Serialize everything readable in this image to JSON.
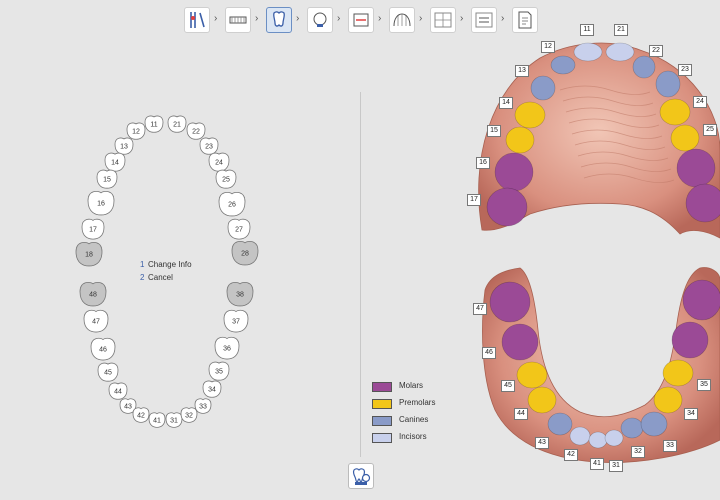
{
  "toolbar": {
    "steps": [
      {
        "name": "step-prepare-icon",
        "active": false
      },
      {
        "name": "step-scan-icon",
        "active": false
      },
      {
        "name": "step-tooth-segmentation-icon",
        "active": true
      },
      {
        "name": "step-face-icon",
        "active": false
      },
      {
        "name": "step-align-icon",
        "active": false
      },
      {
        "name": "step-arch-icon",
        "active": false
      },
      {
        "name": "step-measure-icon",
        "active": false
      },
      {
        "name": "step-setup-icon",
        "active": false
      },
      {
        "name": "step-report-icon",
        "active": false
      }
    ]
  },
  "tooth_chart": {
    "teeth": [
      {
        "num": "11",
        "state": "present"
      },
      {
        "num": "12",
        "state": "present"
      },
      {
        "num": "13",
        "state": "present"
      },
      {
        "num": "14",
        "state": "present"
      },
      {
        "num": "15",
        "state": "present"
      },
      {
        "num": "16",
        "state": "present"
      },
      {
        "num": "17",
        "state": "present"
      },
      {
        "num": "18",
        "state": "missing"
      },
      {
        "num": "21",
        "state": "present"
      },
      {
        "num": "22",
        "state": "present"
      },
      {
        "num": "23",
        "state": "present"
      },
      {
        "num": "24",
        "state": "present"
      },
      {
        "num": "25",
        "state": "present"
      },
      {
        "num": "26",
        "state": "present"
      },
      {
        "num": "27",
        "state": "present"
      },
      {
        "num": "28",
        "state": "missing"
      },
      {
        "num": "48",
        "state": "missing"
      },
      {
        "num": "47",
        "state": "present"
      },
      {
        "num": "46",
        "state": "present"
      },
      {
        "num": "45",
        "state": "present"
      },
      {
        "num": "44",
        "state": "present"
      },
      {
        "num": "43",
        "state": "present"
      },
      {
        "num": "42",
        "state": "present"
      },
      {
        "num": "41",
        "state": "present"
      },
      {
        "num": "31",
        "state": "present"
      },
      {
        "num": "32",
        "state": "present"
      },
      {
        "num": "33",
        "state": "present"
      },
      {
        "num": "34",
        "state": "present"
      },
      {
        "num": "35",
        "state": "present"
      },
      {
        "num": "36",
        "state": "present"
      },
      {
        "num": "37",
        "state": "present"
      },
      {
        "num": "38",
        "state": "missing"
      }
    ],
    "present_fill": "#ffffff",
    "missing_fill": "#c4c4c4"
  },
  "context_menu": {
    "change_info_key": "1",
    "change_info": "Change Info",
    "cancel_key": "2",
    "cancel": "Cancel"
  },
  "legend": [
    {
      "label": "Molars",
      "color": "#9b4a96"
    },
    {
      "label": "Premolars",
      "color": "#f2c619"
    },
    {
      "label": "Canines",
      "color": "#8a9bc8"
    },
    {
      "label": "Incisors",
      "color": "#c8d0ec"
    }
  ],
  "model_view": {
    "gum_color": "#d9907f",
    "upper_labels": [
      "11",
      "12",
      "13",
      "14",
      "15",
      "16",
      "17",
      "21",
      "22",
      "23",
      "24",
      "25"
    ],
    "lower_labels": [
      "47",
      "46",
      "45",
      "44",
      "43",
      "42",
      "41",
      "31",
      "32",
      "33",
      "34",
      "35"
    ]
  },
  "bottom_button": {
    "icon": "tooth-settings-icon"
  }
}
